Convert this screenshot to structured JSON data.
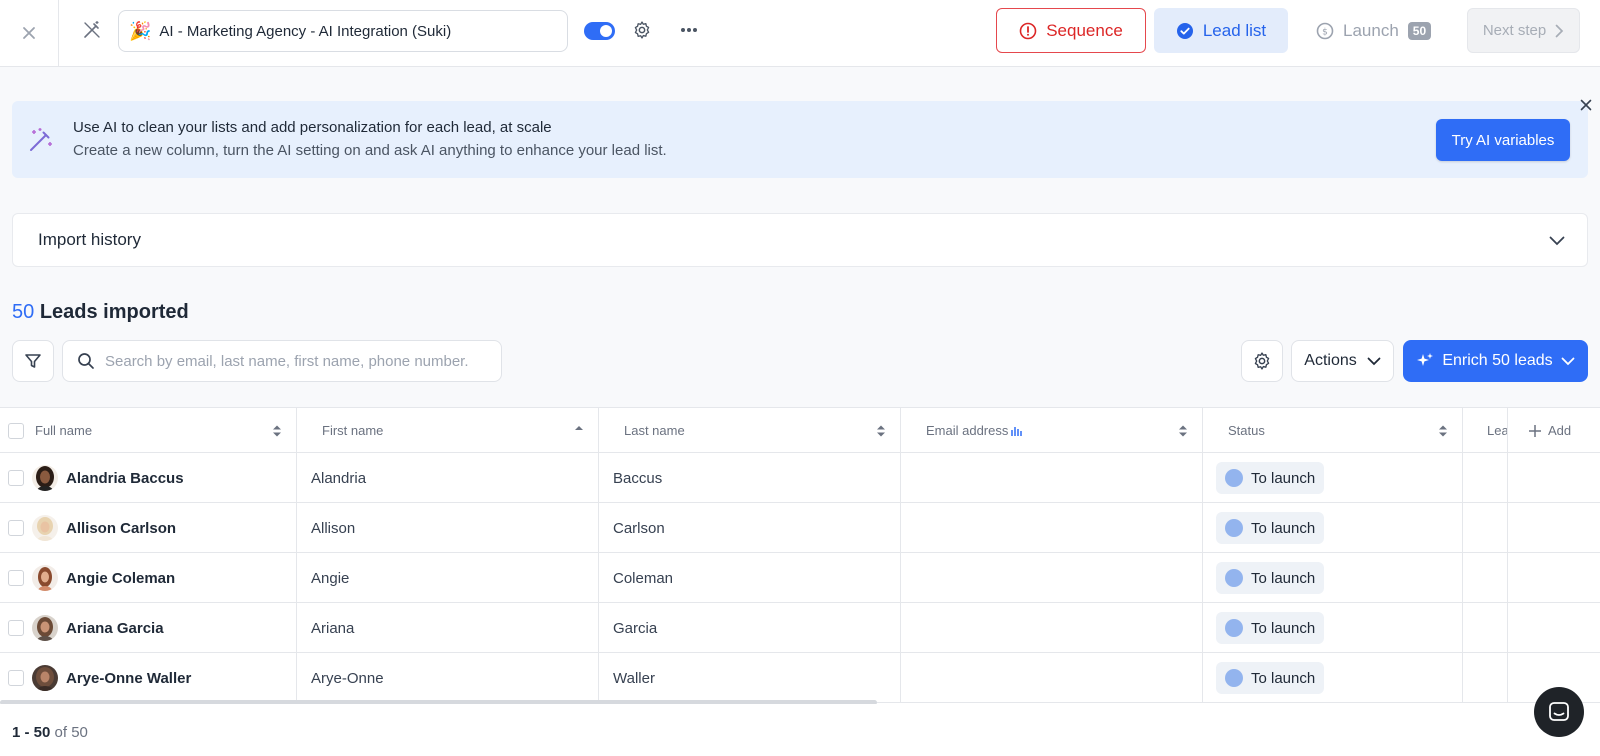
{
  "header": {
    "campaign_emoji": "🎉",
    "campaign_name": "AI - Marketing Agency - AI Integration (Suki)",
    "steps": {
      "sequence": "Sequence",
      "lead_list": "Lead list",
      "launch": "Launch",
      "launch_count": "50",
      "next_step": "Next step"
    }
  },
  "banner": {
    "line1": "Use AI to clean your lists and add personalization for each lead, at scale",
    "line2": "Create a new column, turn the AI setting on and ask AI anything to enhance your lead list.",
    "cta": "Try AI variables"
  },
  "import_history": {
    "title": "Import history"
  },
  "leads": {
    "count": "50",
    "label": "Leads imported",
    "search_placeholder": "Search by email, last name, first name, phone number.",
    "actions_label": "Actions",
    "enrich_label": "Enrich 50 leads"
  },
  "table": {
    "columns": [
      "Full name",
      "First name",
      "Last name",
      "Email address",
      "Status",
      "Lea",
      "Add"
    ],
    "rows": [
      {
        "full_name": "Alandria Baccus",
        "first_name": "Alandria",
        "last_name": "Baccus",
        "email": "",
        "status": "To launch"
      },
      {
        "full_name": "Allison Carlson",
        "first_name": "Allison",
        "last_name": "Carlson",
        "email": "",
        "status": "To launch"
      },
      {
        "full_name": "Angie Coleman",
        "first_name": "Angie",
        "last_name": "Coleman",
        "email": "",
        "status": "To launch"
      },
      {
        "full_name": "Ariana Garcia",
        "first_name": "Ariana",
        "last_name": "Garcia",
        "email": "",
        "status": "To launch"
      },
      {
        "full_name": "Arye-Onne Waller",
        "first_name": "Arye-Onne",
        "last_name": "Waller",
        "email": "",
        "status": "To launch"
      }
    ]
  },
  "pagination": {
    "range": "1 - 50",
    "of_label": "of 50"
  },
  "colors": {
    "primary": "#2f6df6",
    "danger": "#dc2626",
    "banner_bg": "#e7f0fd"
  }
}
